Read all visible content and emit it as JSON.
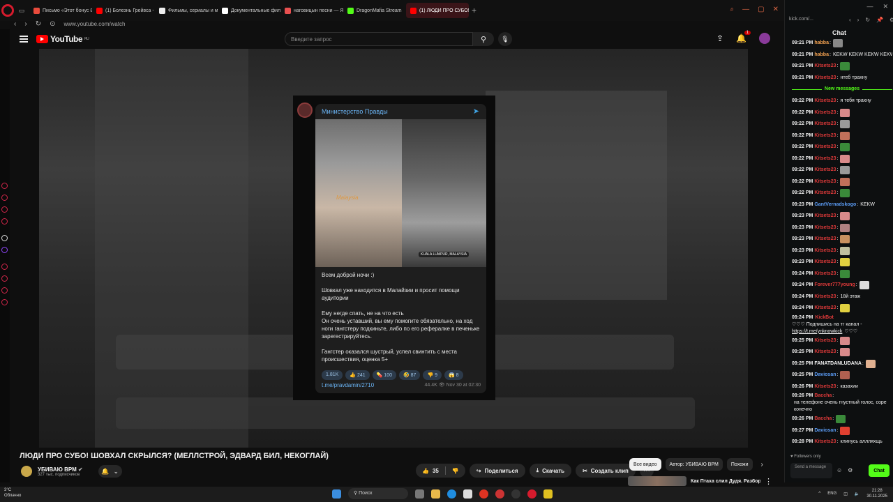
{
  "browser": {
    "tabs": [
      {
        "title": "Письмо «Этот бонус 8Е",
        "color": "#e94b3c"
      },
      {
        "title": "(1) Болезнь Грейвса - Те",
        "color": "#ff0000"
      },
      {
        "title": "Фильмы, сериалы и мул",
        "color": "#eeeeee"
      },
      {
        "title": "Документальные фильм",
        "color": "#ffffff"
      },
      {
        "title": "наговицын песни — Янд",
        "color": "#e95050"
      },
      {
        "title": "DragonMafia Stream",
        "color": "#53fc18"
      },
      {
        "title": "(1) ЛЮДИ ПРО СУБО!",
        "color": "#ff0000"
      }
    ],
    "url": "www.youtube.com/watch"
  },
  "youtube": {
    "logo_text": "YouTube",
    "logo_sup": "RU",
    "search_placeholder": "Введите запрос",
    "notif_count": "1"
  },
  "telegram": {
    "channel": "Министерство Правды",
    "photo_caption_left": "Malaysia",
    "photo_caption_right": "KUALA LUMPUR, MALAYSIA",
    "paragraphs": [
      "Всем доброй ночи :)",
      "Шовкал уже находится в Малайзии и просит помощи аудитории",
      "Ему негде спать, не на что есть\nОн очень уставший, вы ему помогите обязательно, на ход ноги гангстеру подкиньте, либо по его рефералке в печеньке зарегестрируйтесь.",
      "Гангстер оказался шустрый, успел свинтить с места происшествия, оценка 5+"
    ],
    "reactions": [
      "1.81K",
      "👍 241",
      "💊 100",
      "🤣 87",
      "👎 9",
      "😱 8"
    ],
    "link": "t.me/pravdamin/2710",
    "meta": "44.4K 👁  Nov 30 at 02:30"
  },
  "video": {
    "title": "ЛЮДИ ПРО СУБО! ШОВХАЛ СКРЫЛСЯ? (МЕЛЛСТРОЙ, ЭДВАРД БИЛ, НЕКОГЛАЙ)",
    "channel": "УБИВАЮ ВРМ",
    "subs": "327 тыс. подписчиков",
    "likes": "35",
    "share": "Поделиться",
    "download": "Скачать",
    "clip": "Создать клип"
  },
  "chips": [
    "Все видео",
    "Автор: УБИВАЮ ВРМ",
    "Похожи"
  ],
  "reco": {
    "title": "Как Птаха слил Дудя. Разбор"
  },
  "kick": {
    "url": "kick.com/...",
    "title": "Chat",
    "new_messages_label": "New messages",
    "messages_before": [
      {
        "time": "09:21 PM",
        "user": "habba",
        "color": "#f0a050",
        "text": "",
        "emote": "#888"
      },
      {
        "time": "09:21 PM",
        "user": "habba",
        "color": "#f0a050",
        "text": "KEKW KEKW KEKW KEKW",
        "emote": ""
      },
      {
        "time": "09:21 PM",
        "user": "Kitsets23",
        "color": "#e03a3a",
        "text": "",
        "emote": "#3a8a3a"
      },
      {
        "time": "09:21 PM",
        "user": "Kitsets23",
        "color": "#e03a3a",
        "text": "нтеб трахну",
        "emote": ""
      }
    ],
    "messages_after": [
      {
        "time": "09:22 PM",
        "user": "Kitsets23",
        "color": "#e03a3a",
        "text": "я тебя трахну",
        "emote": ""
      },
      {
        "time": "09:22 PM",
        "user": "Kitsets23",
        "color": "#e03a3a",
        "text": "",
        "emote": "#d98a8a"
      },
      {
        "time": "09:22 PM",
        "user": "Kitsets23",
        "color": "#e03a3a",
        "text": "",
        "emote": "#9a9a9a"
      },
      {
        "time": "09:22 PM",
        "user": "Kitsets23",
        "color": "#e03a3a",
        "text": "",
        "emote": "#c0705a"
      },
      {
        "time": "09:22 PM",
        "user": "Kitsets23",
        "color": "#e03a3a",
        "text": "",
        "emote": "#3a8a3a"
      },
      {
        "time": "09:22 PM",
        "user": "Kitsets23",
        "color": "#e03a3a",
        "text": "",
        "emote": "#d98a8a"
      },
      {
        "time": "09:22 PM",
        "user": "Kitsets23",
        "color": "#e03a3a",
        "text": "",
        "emote": "#9a9a9a"
      },
      {
        "time": "09:22 PM",
        "user": "Kitsets23",
        "color": "#e03a3a",
        "text": "",
        "emote": "#c0705a"
      },
      {
        "time": "09:22 PM",
        "user": "Kitsets23",
        "color": "#e03a3a",
        "text": "",
        "emote": "#3a8a3a"
      },
      {
        "time": "09:23 PM",
        "user": "GantVernadskogo",
        "color": "#5b9cf5",
        "text": "KEKW",
        "emote": ""
      },
      {
        "time": "09:23 PM",
        "user": "Kitsets23",
        "color": "#e03a3a",
        "text": "",
        "emote": "#d98a8a"
      },
      {
        "time": "09:23 PM",
        "user": "Kitsets23",
        "color": "#e03a3a",
        "text": "",
        "emote": "#b08080"
      },
      {
        "time": "09:23 PM",
        "user": "Kitsets23",
        "color": "#e03a3a",
        "text": "",
        "emote": "#c89060"
      },
      {
        "time": "09:23 PM",
        "user": "Kitsets23",
        "color": "#e03a3a",
        "text": "",
        "emote": "#c0c0a0"
      },
      {
        "time": "09:23 PM",
        "user": "Kitsets23",
        "color": "#e03a3a",
        "text": "",
        "emote": "#e0d040"
      },
      {
        "time": "09:24 PM",
        "user": "Kitsets23",
        "color": "#e03a3a",
        "text": "",
        "emote": "#3a8a3a"
      },
      {
        "time": "09:24 PM",
        "user": "Forever777young",
        "color": "#e03a3a",
        "text": "",
        "emote": "#dddddd"
      },
      {
        "time": "09:24 PM",
        "user": "Kitsets23",
        "color": "#e03a3a",
        "text": "18й этаж",
        "emote": ""
      },
      {
        "time": "09:24 PM",
        "user": "Kitsets23",
        "color": "#e03a3a",
        "text": "",
        "emote": "#e0d040"
      }
    ],
    "bot_message": {
      "time": "09:24 PM",
      "user": "KickBot",
      "color": "#e03a3a",
      "text": "♡♡♡ Подпишись на тг канал -",
      "link": "https://t.me/ynknowkick",
      "tail": "♡♡♡"
    },
    "messages_end": [
      {
        "time": "09:25 PM",
        "user": "Kitsets23",
        "color": "#e03a3a",
        "text": "",
        "emote": "#d98a8a"
      },
      {
        "time": "09:25 PM",
        "user": "Kitsets23",
        "color": "#e03a3a",
        "text": "",
        "emote": "#d98a8a"
      },
      {
        "time": "09:25 PM",
        "user": "FANATDANLUDANA",
        "color": "#f1f1f1",
        "text": "",
        "emote": "#e0b090"
      },
      {
        "time": "09:25 PM",
        "user": "Daviosan",
        "color": "#5b9cf5",
        "text": "",
        "emote": "#b06050"
      },
      {
        "time": "09:26 PM",
        "user": "Kitsets23",
        "color": "#e03a3a",
        "text": "казахии",
        "emote": ""
      },
      {
        "time": "09:26 PM",
        "user": "Baccha",
        "color": "#e03a3a",
        "text": "на телефоне очень гнустный голос, соре конечно",
        "emote": ""
      },
      {
        "time": "09:26 PM",
        "user": "Baccha",
        "color": "#e03a3a",
        "text": "",
        "emote": "#3a8a3a"
      },
      {
        "time": "09:27 PM",
        "user": "Daviosan",
        "color": "#5b9cf5",
        "text": "",
        "emote": "#e04030"
      },
      {
        "time": "09:28 PM",
        "user": "Kitsets23",
        "color": "#e03a3a",
        "text": "клинусь аллляхщь",
        "emote": ""
      }
    ],
    "followers_only": "Followers only",
    "send_placeholder": "Send a message",
    "chat_button": "Chat"
  },
  "taskbar": {
    "weather_temp": "3°C",
    "weather_desc": "Облачно",
    "search": "Поиск",
    "lang": "ENG",
    "time": "21:28",
    "date": "30.11.2025"
  }
}
